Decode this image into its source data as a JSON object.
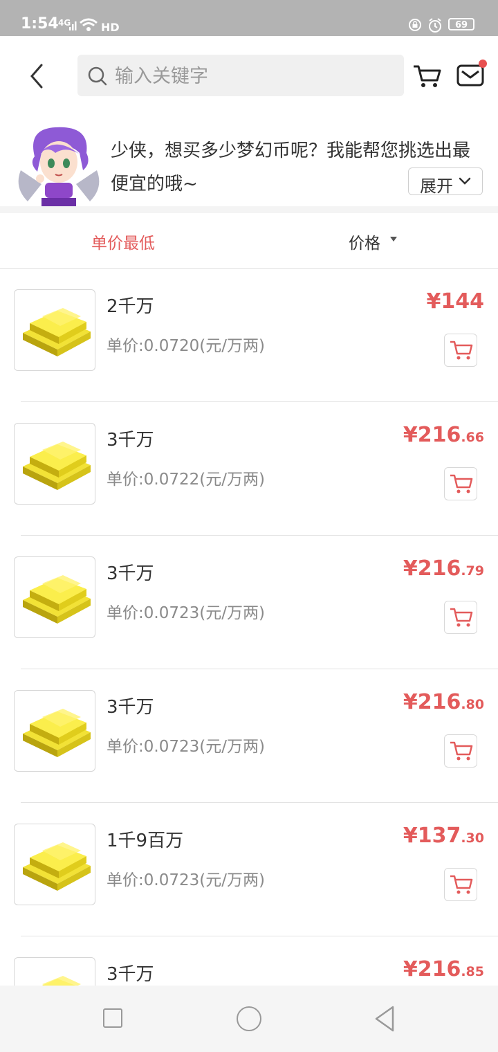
{
  "status_bar": {
    "time": "1:54",
    "network": "4G",
    "hd": "HD",
    "battery": "69"
  },
  "header": {
    "search_placeholder": "输入关键字",
    "icons": [
      "back-arrow-icon",
      "search-icon",
      "cart-icon",
      "mail-icon"
    ],
    "mail_badge_color": "#e85050"
  },
  "banner": {
    "text": "少侠，想买多少梦幻币呢？我能帮您挑选出最便宜的哦~",
    "expand_label": "展开"
  },
  "sort": {
    "lowest_label": "单价最低",
    "price_label": "价格"
  },
  "items": [
    {
      "name": "2千万",
      "unit_price": "单价:0.0720(元/万两)",
      "currency": "¥",
      "price_int": "144",
      "price_dec": ""
    },
    {
      "name": "3千万",
      "unit_price": "单价:0.0722(元/万两)",
      "currency": "¥",
      "price_int": "216",
      "price_dec": ".66"
    },
    {
      "name": "3千万",
      "unit_price": "单价:0.0723(元/万两)",
      "currency": "¥",
      "price_int": "216",
      "price_dec": ".79"
    },
    {
      "name": "3千万",
      "unit_price": "单价:0.0723(元/万两)",
      "currency": "¥",
      "price_int": "216",
      "price_dec": ".80"
    },
    {
      "name": "1千9百万",
      "unit_price": "单价:0.0723(元/万两)",
      "currency": "¥",
      "price_int": "137",
      "price_dec": ".30"
    },
    {
      "name": "3千万",
      "unit_price": "",
      "currency": "¥",
      "price_int": "216",
      "price_dec": ".85"
    }
  ],
  "colors": {
    "accent": "#e35b5b",
    "status_bar": "#b3b3b3",
    "gold": "#e8d21a"
  }
}
